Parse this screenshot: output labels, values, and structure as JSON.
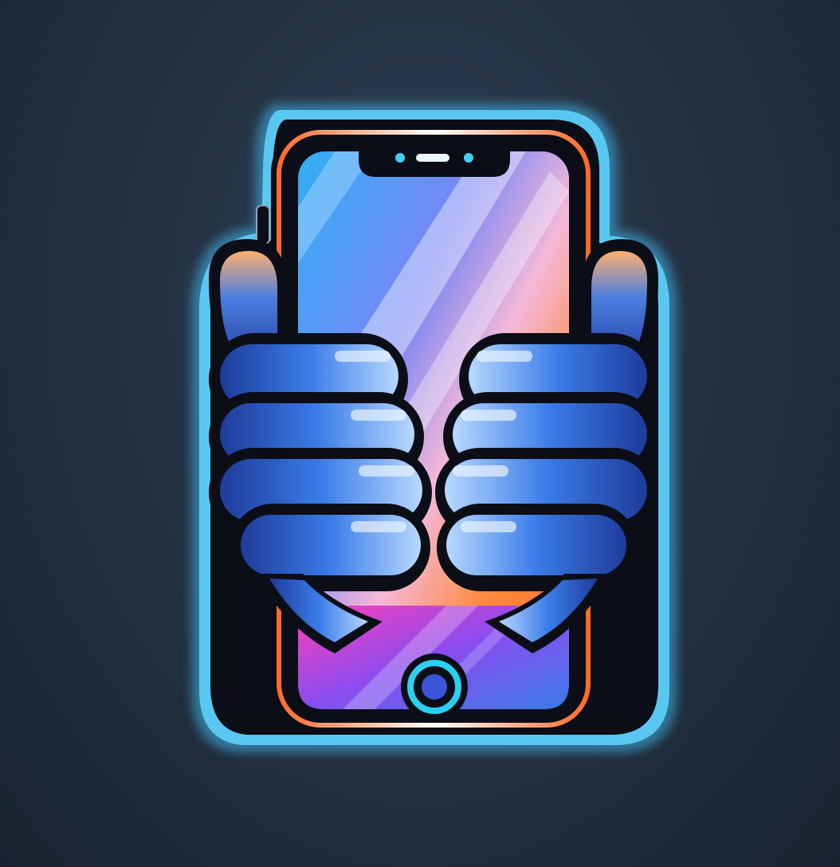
{
  "colors": {
    "background": "#243243",
    "outline_glow": "#3fb3e6",
    "outline_dark": "#0b0e16",
    "phone_frame_accent": "#ff6a2a",
    "screen_gradient": [
      "#2fa8f0",
      "#8a6cf0",
      "#ff8a3a",
      "#e94fd0"
    ],
    "hands": [
      "#2a4fb8",
      "#3a7ce8",
      "#9ad0ff"
    ],
    "home_button_ring": "#2ad0f0"
  },
  "icons": {
    "logo": "phone-held-by-hands-logo",
    "home_button": "home-button-icon",
    "front_camera": "camera-notch-icon"
  }
}
